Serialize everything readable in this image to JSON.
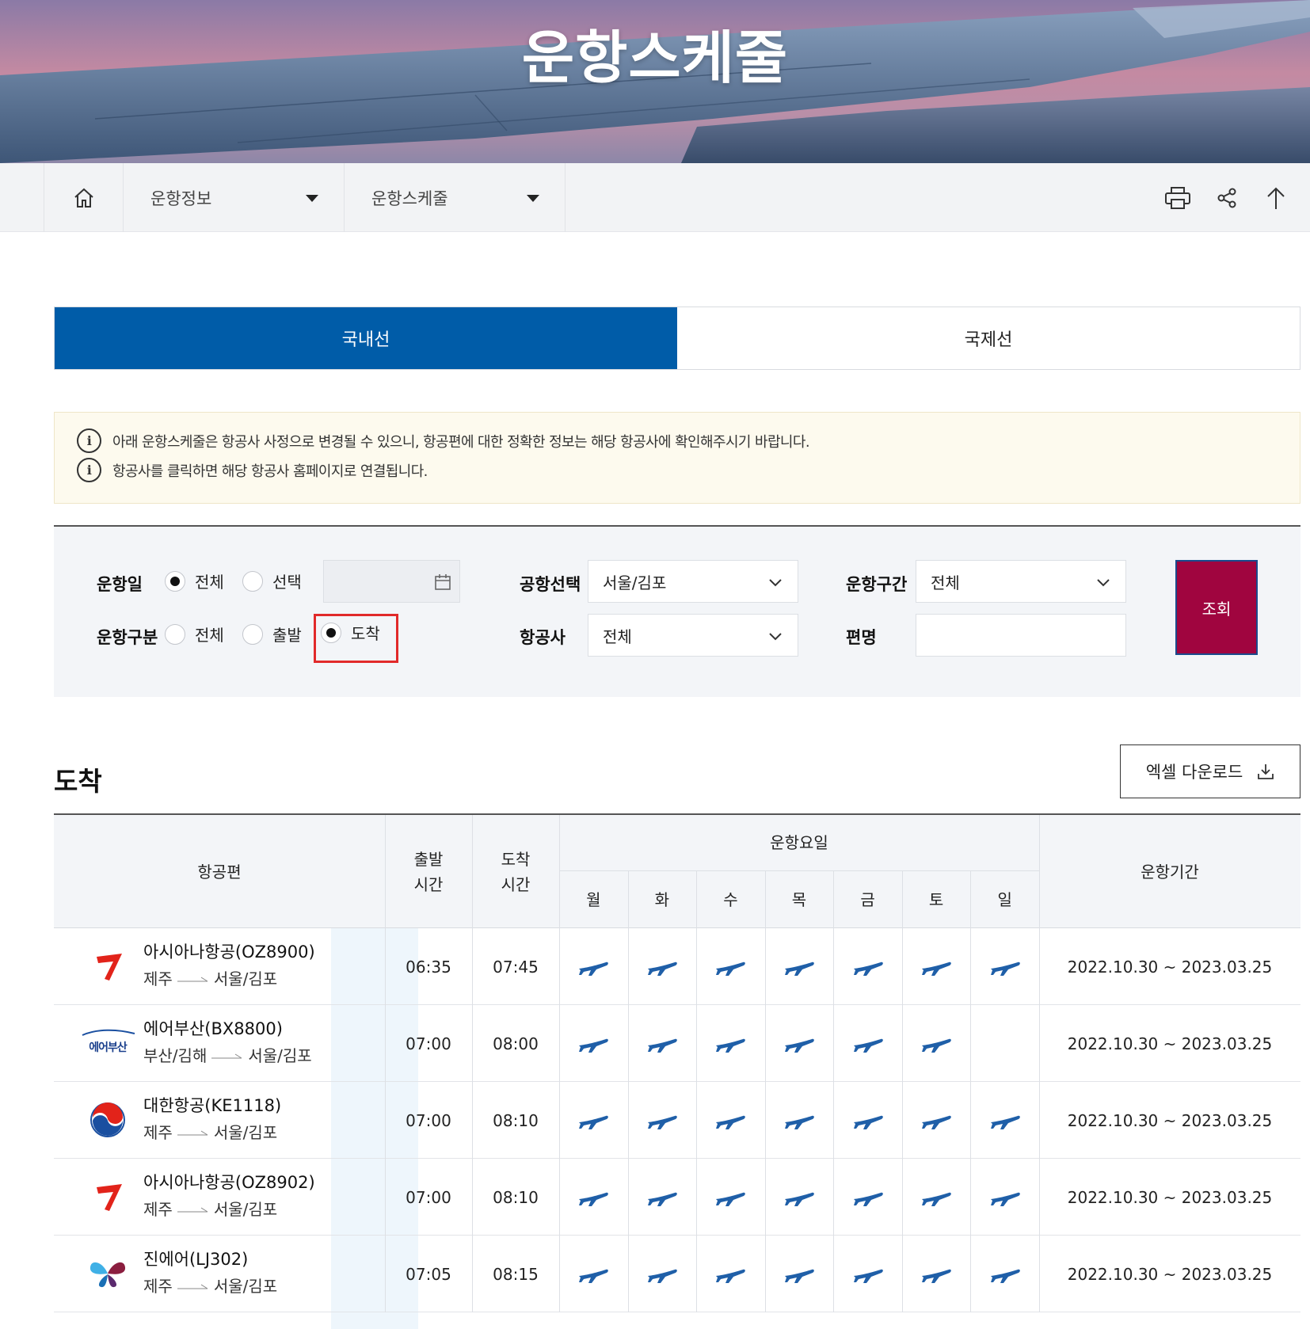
{
  "hero": {
    "title": "운항스케줄"
  },
  "breadcrumb": {
    "home_icon": "home-icon",
    "level1": "운항정보",
    "level2": "운항스케줄",
    "tools": [
      "print-icon",
      "share-icon",
      "scroll-top-icon"
    ]
  },
  "tabs": [
    {
      "label": "국내선",
      "active": true
    },
    {
      "label": "국제선",
      "active": false
    }
  ],
  "notice": [
    "아래 운항스케줄은 항공사 사정으로 변경될 수 있으니, 항공편에 대한 정확한 정보는 해당 항공사에 확인해주시기 바랍니다.",
    "항공사를 클릭하면 해당 항공사 홈페이지로 연결됩니다."
  ],
  "filter": {
    "date_label": "운항일",
    "date_options": [
      "전체",
      "선택"
    ],
    "date_selected": "전체",
    "date_value": "",
    "type_label": "운항구분",
    "type_options": [
      "전체",
      "출발",
      "도착"
    ],
    "type_selected": "도착",
    "airport_label": "공항선택",
    "airport_value": "서울/김포",
    "airline_label": "항공사",
    "airline_value": "전체",
    "section_label": "운항구간",
    "section_value": "전체",
    "flightno_label": "편명",
    "flightno_value": "",
    "search_label": "조회",
    "accent_color": "#a0053f"
  },
  "section": {
    "title": "도착",
    "excel_label": "엑셀 다운로드"
  },
  "table": {
    "headers": {
      "flight": "항공편",
      "dep": "출발\n시간",
      "arr": "도착\n시간",
      "days_group": "운항요일",
      "days": [
        "월",
        "화",
        "수",
        "목",
        "금",
        "토",
        "일"
      ],
      "period": "운항기간"
    },
    "rows": [
      {
        "logo": "asiana-logo",
        "flight": "아시아나항공(OZ8900)",
        "from": "제주",
        "to": "서울/김포",
        "dep": "06:35",
        "arr": "07:45",
        "days": [
          true,
          true,
          true,
          true,
          true,
          true,
          true
        ],
        "period": "2022.10.30 ~ 2023.03.25"
      },
      {
        "logo": "airbusan-logo",
        "logo_text": "에어부산",
        "flight": "에어부산(BX8800)",
        "from": "부산/김해",
        "to": "서울/김포",
        "dep": "07:00",
        "arr": "08:00",
        "days": [
          true,
          true,
          true,
          true,
          true,
          true,
          false
        ],
        "period": "2022.10.30 ~ 2023.03.25"
      },
      {
        "logo": "koreanair-logo",
        "flight": "대한항공(KE1118)",
        "from": "제주",
        "to": "서울/김포",
        "dep": "07:00",
        "arr": "08:10",
        "days": [
          true,
          true,
          true,
          true,
          true,
          true,
          true
        ],
        "period": "2022.10.30 ~ 2023.03.25"
      },
      {
        "logo": "asiana-logo",
        "flight": "아시아나항공(OZ8902)",
        "from": "제주",
        "to": "서울/김포",
        "dep": "07:00",
        "arr": "08:10",
        "days": [
          true,
          true,
          true,
          true,
          true,
          true,
          true
        ],
        "period": "2022.10.30 ~ 2023.03.25"
      },
      {
        "logo": "jinair-logo",
        "flight": "진에어(LJ302)",
        "from": "제주",
        "to": "서울/김포",
        "dep": "07:05",
        "arr": "08:15",
        "days": [
          true,
          true,
          true,
          true,
          true,
          true,
          true
        ],
        "period": "2022.10.30 ~ 2023.03.25"
      }
    ]
  }
}
